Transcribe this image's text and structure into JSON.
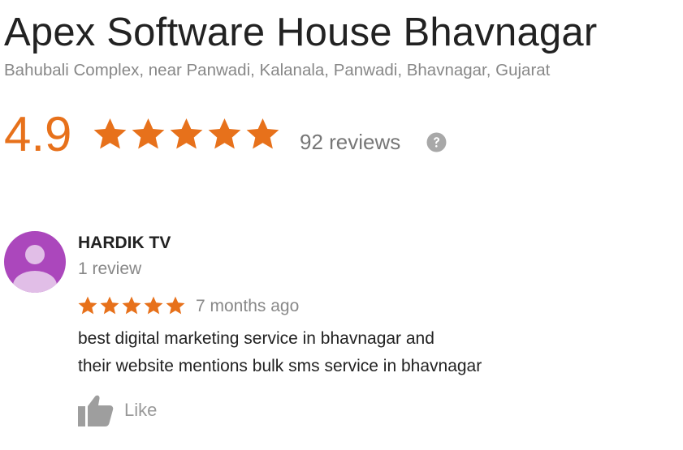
{
  "business": {
    "name": "Apex Software House Bhavnagar",
    "address": "Bahubali Complex, near Panwadi, Kalanala, Panwadi, Bhavnagar, Gujarat",
    "rating": "4.9",
    "rating_stars": 5,
    "reviews_count": "92 reviews",
    "help_icon": "question-circle-icon"
  },
  "review": {
    "reviewer_name": "HARDIK TV",
    "reviewer_review_count": "1 review",
    "avatar_icon": "person-avatar-icon",
    "stars": 5,
    "time": "7 months ago",
    "text_lines": [
      "best digital marketing service in bhavnagar and",
      "their website mentions bulk sms service in bhavnagar"
    ],
    "like_label": "Like",
    "like_icon": "thumbs-up-icon"
  },
  "colors": {
    "star": "#e7711b",
    "rating": "#e7711b",
    "avatar_bg": "#ab47bc",
    "avatar_figure": "#e1bee7",
    "muted_text": "#888888",
    "icon_gray": "#9e9e9e"
  }
}
